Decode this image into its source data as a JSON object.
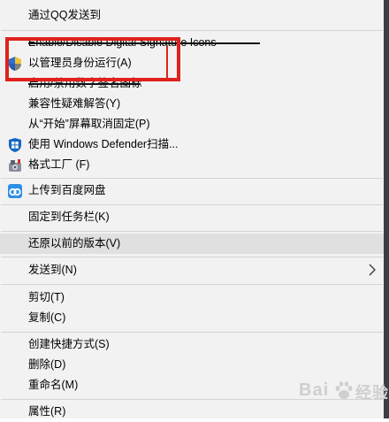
{
  "menu": {
    "items": [
      {
        "label": "通过QQ发送到"
      },
      {
        "label": "Enable/Disable Digital Signature Icons"
      },
      {
        "label": "以管理员身份运行(A)"
      },
      {
        "label": "启用/禁用数字签名图标"
      },
      {
        "label": "兼容性疑难解答(Y)"
      },
      {
        "label": "从“开始”屏幕取消固定(P)"
      },
      {
        "label": "使用 Windows Defender扫描..."
      },
      {
        "label": "格式工厂 (F)"
      },
      {
        "label": "上传到百度网盘"
      },
      {
        "label": "固定到任务栏(K)"
      },
      {
        "label": "还原以前的版本(V)"
      },
      {
        "label": "发送到(N)"
      },
      {
        "label": "剪切(T)"
      },
      {
        "label": "复制(C)"
      },
      {
        "label": "创建快捷方式(S)"
      },
      {
        "label": "删除(D)"
      },
      {
        "label": "重命名(M)"
      },
      {
        "label": "属性(R)"
      }
    ]
  },
  "watermark": {
    "text_a": "Bai",
    "text_b": "经验"
  },
  "colors": {
    "menu_bg": "#f2f2f2",
    "highlight": "#e0e0e0",
    "annotation": "#e0211c",
    "separator": "#d4d4d4"
  },
  "icons": {
    "run_as_admin": "uac-shield-icon",
    "defender": "windows-defender-shield-icon",
    "format_factory": "format-factory-icon",
    "baidu_netdisk": "baidu-netdisk-cloud-icon",
    "submenu": "chevron-right-icon"
  }
}
